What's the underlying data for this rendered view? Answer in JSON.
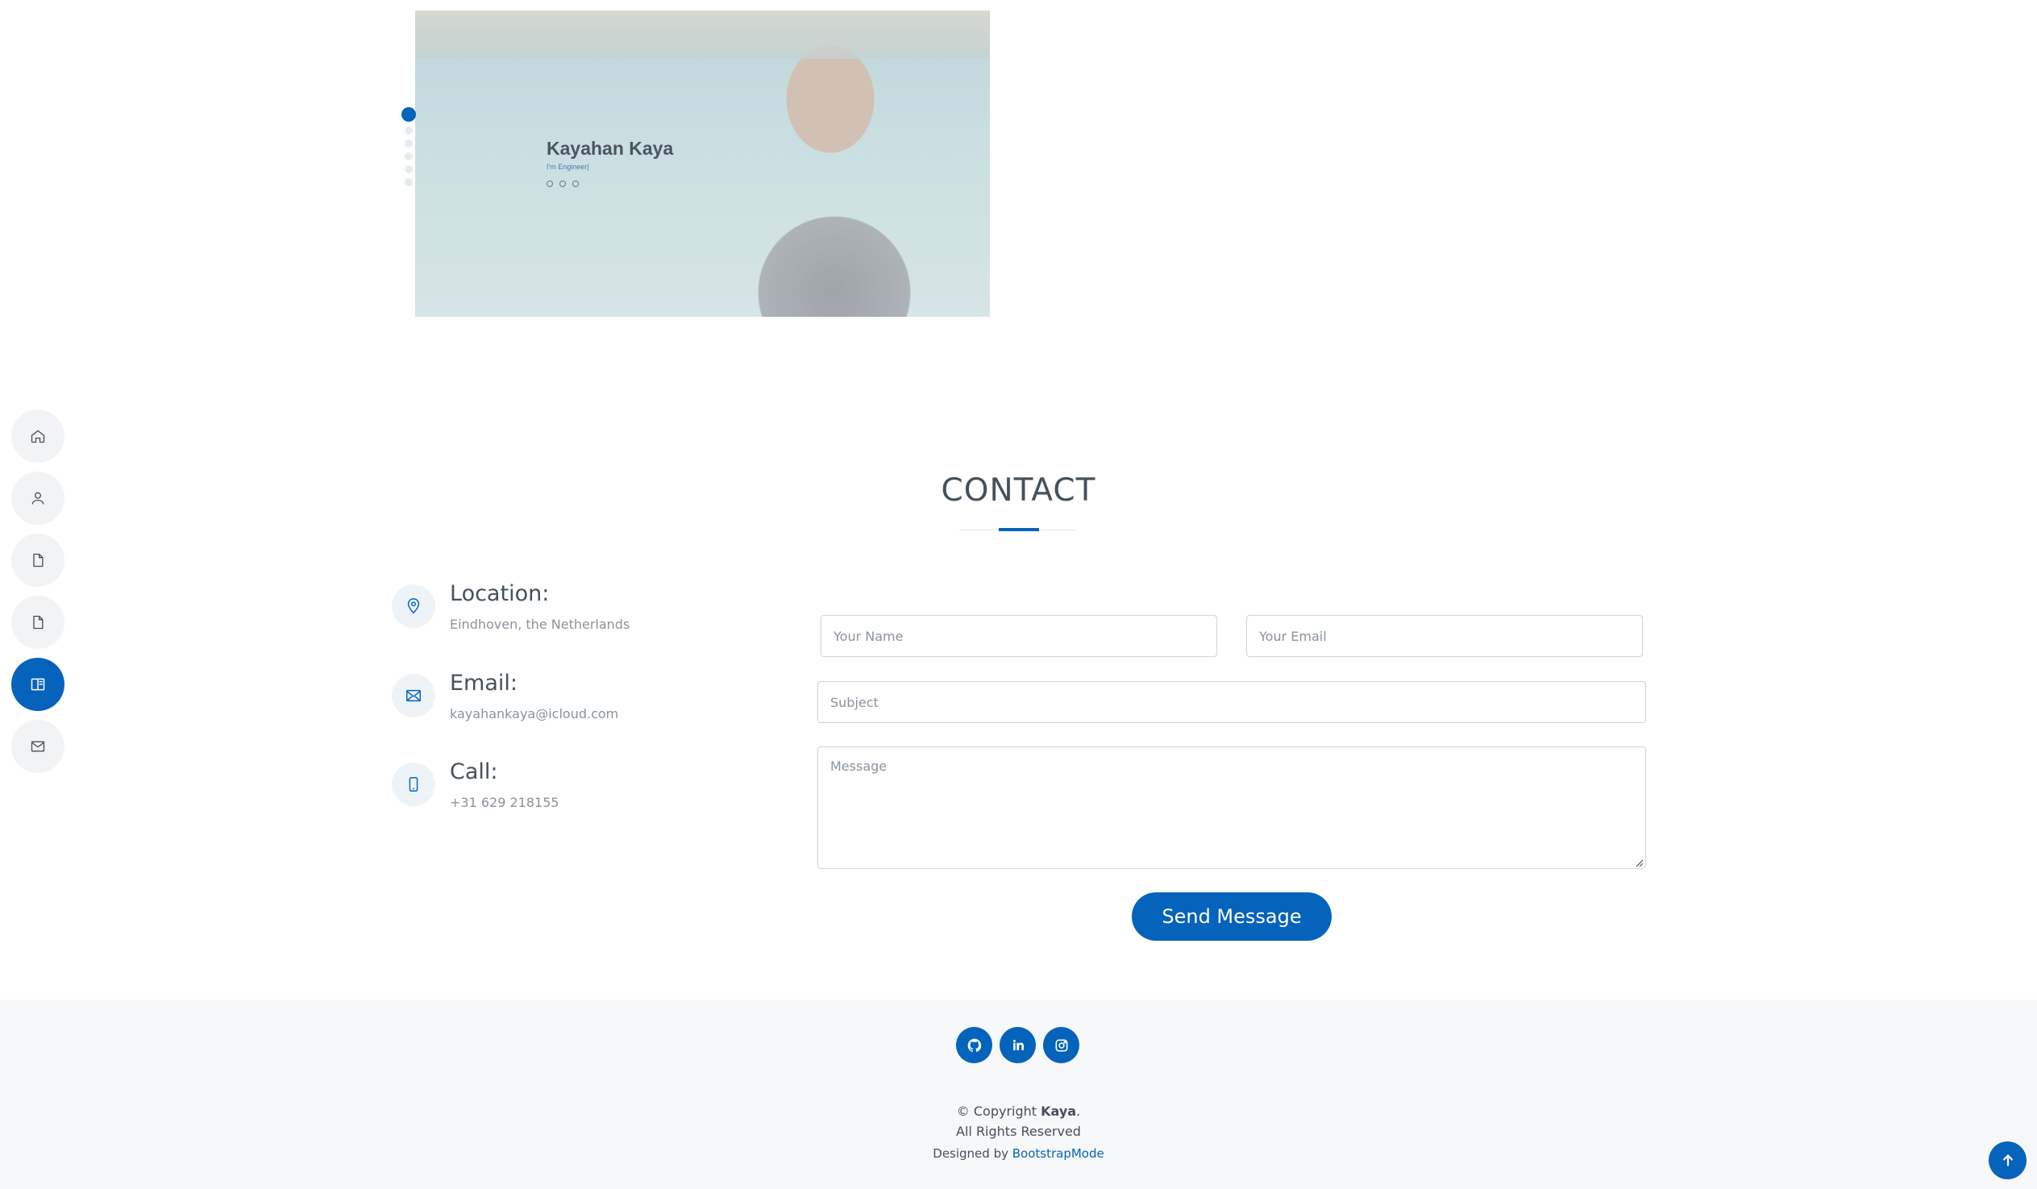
{
  "preview": {
    "name": "Kayahan Kaya",
    "subtitle": "I'm Engineer|"
  },
  "sidenav": {
    "items": [
      {
        "icon": "home-icon",
        "active": false
      },
      {
        "icon": "person-icon",
        "active": false
      },
      {
        "icon": "file-icon",
        "active": false
      },
      {
        "icon": "file-icon",
        "active": false
      },
      {
        "icon": "book-icon",
        "active": true
      },
      {
        "icon": "envelope-icon",
        "active": false
      }
    ]
  },
  "contact": {
    "title": "CONTACT",
    "location": {
      "label": "Location:",
      "value": "Eindhoven, the Netherlands",
      "icon": "map-pin-icon"
    },
    "email": {
      "label": "Email:",
      "value": "kayahankaya@icloud.com",
      "icon": "envelope-icon"
    },
    "call": {
      "label": "Call:",
      "value": "+31 629 218155",
      "icon": "phone-icon"
    }
  },
  "form": {
    "name_placeholder": "Your Name",
    "email_placeholder": "Your Email",
    "subject_placeholder": "Subject",
    "message_placeholder": "Message",
    "send_label": "Send Message"
  },
  "footer": {
    "social": [
      "github-icon",
      "linkedin-icon",
      "instagram-icon"
    ],
    "copyright_prefix": "© Copyright ",
    "copyright_name": "Kaya",
    "copyright_suffix": ".",
    "rights": "All Rights Reserved",
    "designed_prefix": "Designed by ",
    "designed_link": "BootstrapMode"
  },
  "colors": {
    "accent": "#0563bb",
    "text": "#45505b",
    "muted": "#8a939c"
  }
}
